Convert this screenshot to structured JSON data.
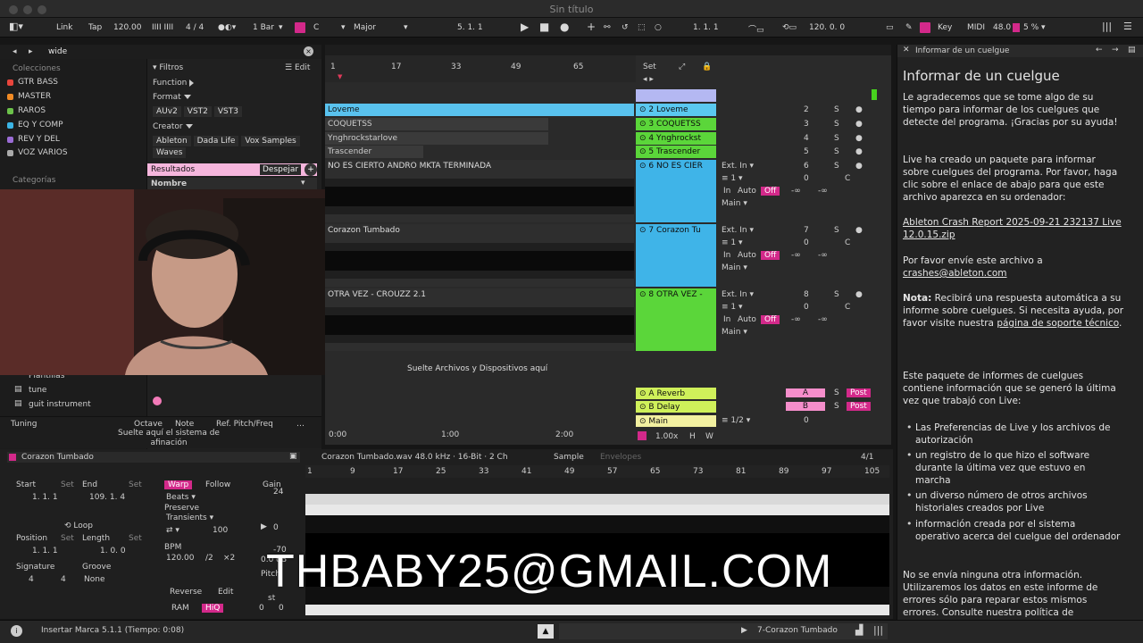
{
  "window": {
    "title": "Sin título"
  },
  "toolbar": {
    "link": "Link",
    "tap": "Tap",
    "tempo": "120.00",
    "signature": "4 / 4",
    "quant": "1 Bar",
    "key": "C",
    "scale": "Major",
    "position": "5. 1. 1",
    "loop_start": "1. 1. 1",
    "loop_len": "120. 0. 0",
    "key_label": "Key",
    "midi": "MIDI",
    "sample_rate": "48.0",
    "cpu": "5 %"
  },
  "browser": {
    "search": "wide",
    "collections_header": "Colecciones",
    "collections": [
      {
        "name": "GTR BASS",
        "color": "#e8453c"
      },
      {
        "name": "MASTER",
        "color": "#f08a24"
      },
      {
        "name": "RAROS",
        "color": "#6cc24a"
      },
      {
        "name": "EQ Y COMP",
        "color": "#3bb4e5"
      },
      {
        "name": "REV Y DEL",
        "color": "#9b6cd6"
      },
      {
        "name": "VOZ VARIOS",
        "color": "#aaaaaa"
      }
    ],
    "categories_header": "Categorías",
    "filters": "Filtros",
    "edit": "Edit",
    "function": "Function",
    "format": "Format",
    "formats": [
      "AUv2",
      "VST2",
      "VST3"
    ],
    "creator": "Creator",
    "creators": [
      "Ableton",
      "Dada Life",
      "Vox Samples",
      "Waves"
    ],
    "results": "Resultados",
    "clear": "Despejar",
    "name_col": "Nombre",
    "places": [
      "Plantillas",
      "tune",
      "guit instrument"
    ],
    "tuning": "Tuning",
    "octave": "Octave",
    "note": "Note",
    "ref": "Ref. Pitch/Freq",
    "tuning_hint": "Suelte aquí el sistema de afinación"
  },
  "arrangement": {
    "ruler": [
      "1",
      "17",
      "33",
      "49",
      "65"
    ],
    "set": "Set",
    "time_ruler": [
      "0:00",
      "1:00",
      "2:00"
    ],
    "drop_hint": "Suelte Archivos y Dispositivos aquí",
    "zoom": "1.00x",
    "h": "H",
    "w": "W"
  },
  "tracks": [
    {
      "clip": "Loveme",
      "head": "2 Loveme",
      "num": "2",
      "color": "#5ac8f0"
    },
    {
      "clip": "COQUETSS",
      "head": "3 COQUETSS",
      "num": "3",
      "color": "#5bd63a"
    },
    {
      "clip": "Ynghrockstarlove",
      "head": "4 Ynghrockst",
      "num": "4",
      "color": "#5bd63a"
    },
    {
      "clip": "Trascender",
      "head": "5 Trascender",
      "num": "5",
      "color": "#5bd63a"
    }
  ],
  "audio_tracks": [
    {
      "clip": "NO ES CIERTO ANDRO MKTA TERMINADA",
      "head": "6 NO ES CIER",
      "num": "6",
      "color": "#3fb4e8",
      "input": "Ext. In",
      "ch": "1",
      "out": "Main"
    },
    {
      "clip": "Corazon Tumbado",
      "head": "7 Corazon Tu",
      "num": "7",
      "color": "#3fb4e8",
      "input": "Ext. In",
      "ch": "1",
      "out": "Main"
    },
    {
      "clip": "OTRA VEZ - CROUZZ 2.1",
      "head": "8 OTRA VEZ -",
      "num": "8",
      "color": "#5bd63a",
      "input": "Ext. In",
      "ch": "1",
      "out": "Main"
    }
  ],
  "returns": [
    {
      "name": "A Reverb",
      "send": "A"
    },
    {
      "name": "B Delay",
      "send": "B"
    },
    {
      "name": "Main",
      "send": "1/2"
    }
  ],
  "mixer_labels": {
    "s": "S",
    "in": "In",
    "auto": "Auto",
    "off": "Off",
    "inf": "-∞",
    "zero": "0",
    "c": "C",
    "post": "Post"
  },
  "info": {
    "header": "Informar de un cuelgue",
    "title": "Informar de un cuelgue",
    "p1": "Le agradecemos que se tome algo de su tiempo para informar de los cuelgues que detecte del programa. ¡Gracias por su ayuda!",
    "p2": "Live ha creado un paquete para informar sobre cuelgues del programa. Por favor, haga clic sobre el enlace de abajo para que este archivo aparezca en su ordenador:",
    "link": "Ableton Crash Report 2025-09-21 232137 Live 12.0.15.zip",
    "p3a": "Por favor envíe este archivo a",
    "email": "crashes@ableton.com",
    "p4a": "Nota:",
    "p4b": "Recibirá una respuesta automática a su informe sobre cuelgues. Si necesita ayuda, por favor visite nuestra",
    "p4link": "página de soporte técnico",
    "p5": "Este paquete de informes de cuelgues contiene información que se generó la última vez que trabajó con Live:",
    "bullets": [
      "Las Preferencias de Live y los archivos de autorización",
      "un registro de lo que hizo el software durante la última vez que estuvo en marcha",
      "un diverso número de otros archivos historiales creados por Live",
      "información creada por el sistema operativo acerca del cuelgue del ordenador"
    ],
    "p6": "No se envía ninguna otra información. Utilizaremos los datos en este informe de errores sólo para reparar estos mismos errores. Consulte nuestra política de"
  },
  "clip_detail": {
    "name": "Corazon Tumbado",
    "file": "Corazon Tumbado.wav  48.0 kHz · 16-Bit · 2 Ch",
    "sample": "Sample",
    "envelopes": "Envelopes",
    "page": "4/1",
    "start": "Start",
    "end": "End",
    "set": "Set",
    "start_val": "1.  1.  1",
    "end_val": "109.  1.  4",
    "loop": "Loop",
    "position": "Position",
    "length": "Length",
    "pos_val": "1.  1.  1",
    "len_val": "1.  0.  0",
    "signature": "Signature",
    "groove": "Groove",
    "sig_num": "4",
    "sig_den": "4",
    "groove_val": "None",
    "warp": "Warp",
    "follow": "Follow",
    "beats": "Beats",
    "preserve": "Preserve",
    "transients": "Transients",
    "tval": "100",
    "bpm": "BPM",
    "bpm_val": "120.00",
    "half": "/2",
    "double": "×2",
    "reverse": "Reverse",
    "edit": "Edit",
    "ram": "RAM",
    "hiq": "HiQ",
    "gain": "Gain",
    "gain_top": "24",
    "gain_mid": "0",
    "gain_bottom": "-70",
    "gain_db": "0.0 dB",
    "pitch": "Pitch",
    "st": "st",
    "st_a": "0",
    "st_b": "0",
    "ruler": [
      "1",
      "9",
      "17",
      "25",
      "33",
      "41",
      "49",
      "57",
      "65",
      "73",
      "81",
      "89",
      "97",
      "105"
    ]
  },
  "status": {
    "message": "Insertar Marca 5.1.1 (Tiempo: 0:08)",
    "track": "7-Corazon Tumbado"
  },
  "overlay": {
    "text": "THBABY25@GMAIL.COM"
  }
}
